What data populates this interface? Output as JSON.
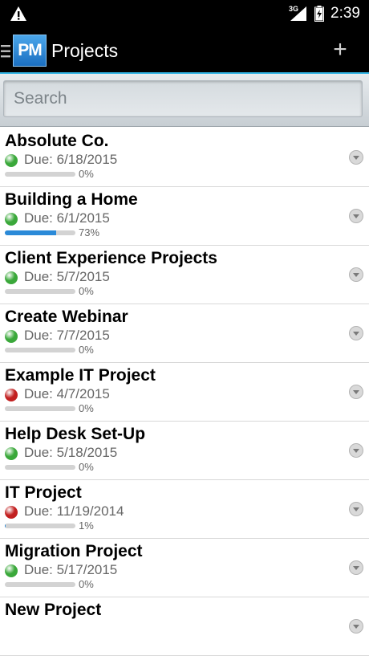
{
  "status_bar": {
    "network": "3G",
    "time": "2:39",
    "icons": [
      "warning-icon",
      "signal-icon",
      "battery-icon"
    ]
  },
  "app_bar": {
    "logo_text": "PM",
    "title": "Projects",
    "add_label": "+",
    "icons": [
      "menu-icon",
      "add-icon"
    ]
  },
  "search": {
    "placeholder": "Search",
    "value": ""
  },
  "colors": {
    "accent": "#33b5e5",
    "status_green": "#3aa83a",
    "status_red": "#c22020",
    "progress": "#2b8ad8"
  },
  "projects": [
    {
      "name": "Absolute Co.",
      "due": "Due: 6/18/2015",
      "status": "green",
      "progress": 0,
      "progress_text": "0%"
    },
    {
      "name": "Building a Home",
      "due": "Due: 6/1/2015",
      "status": "green",
      "progress": 73,
      "progress_text": "73%"
    },
    {
      "name": "Client Experience Projects",
      "due": "Due: 5/7/2015",
      "status": "green",
      "progress": 0,
      "progress_text": "0%"
    },
    {
      "name": "Create Webinar",
      "due": "Due: 7/7/2015",
      "status": "green",
      "progress": 0,
      "progress_text": "0%"
    },
    {
      "name": "Example IT Project",
      "due": "Due: 4/7/2015",
      "status": "red",
      "progress": 0,
      "progress_text": "0%"
    },
    {
      "name": "Help Desk Set-Up",
      "due": "Due: 5/18/2015",
      "status": "green",
      "progress": 0,
      "progress_text": "0%"
    },
    {
      "name": "IT Project",
      "due": "Due: 11/19/2014",
      "status": "red",
      "progress": 1,
      "progress_text": "1%"
    },
    {
      "name": "Migration Project",
      "due": "Due: 5/17/2015",
      "status": "green",
      "progress": 0,
      "progress_text": "0%"
    },
    {
      "name": "New Project",
      "due": "",
      "status": "",
      "progress": 0,
      "progress_text": ""
    }
  ]
}
